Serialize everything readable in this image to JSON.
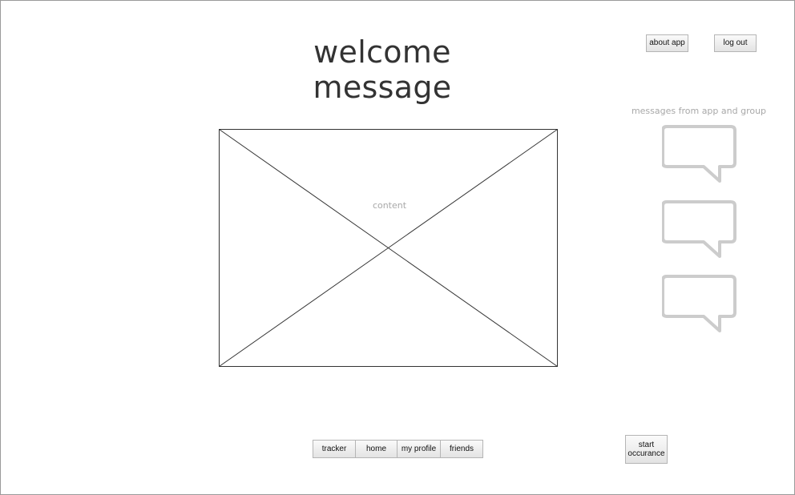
{
  "header": {
    "title": "welcome message",
    "about_label": "about app",
    "logout_label": "log out"
  },
  "main": {
    "content_label": "content"
  },
  "messages": {
    "label": "messages from app and group",
    "bubbles": [
      "speech-bubble-icon",
      "speech-bubble-icon",
      "speech-bubble-icon"
    ]
  },
  "nav": {
    "tabs": [
      {
        "label": "tracker"
      },
      {
        "label": "home"
      },
      {
        "label": "my profile"
      },
      {
        "label": "friends"
      }
    ]
  },
  "actions": {
    "start_line1": "start",
    "start_line2": "occurance"
  },
  "colors": {
    "placeholder_lines": "#333333",
    "muted_text": "#a8a8a8",
    "bubble_stroke": "#cccccc"
  }
}
